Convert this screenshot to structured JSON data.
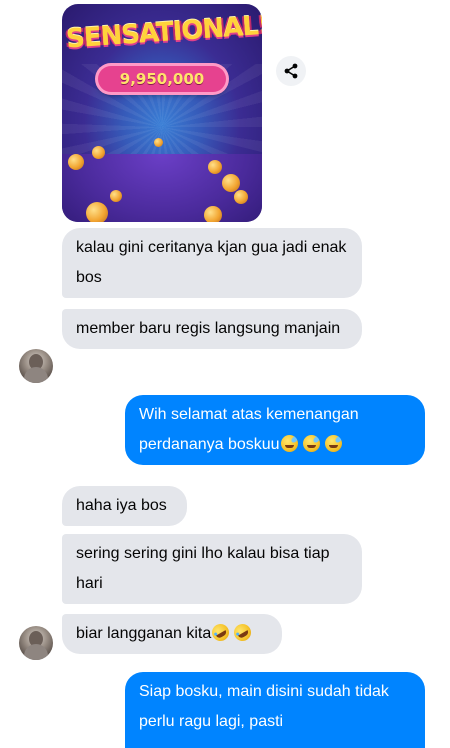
{
  "shared_image": {
    "title": "SENSATIONAL!",
    "amount": "9,950,000"
  },
  "messages": [
    {
      "text": "kalau gini ceritanya kjan gua jadi enak bos"
    },
    {
      "text": "member baru regis langsung manjain"
    },
    {
      "text": "Wih selamat atas kemenangan perdananya boskuu",
      "emoji": [
        "sweat-smile",
        "sweat-smile",
        "sweat-smile"
      ]
    },
    {
      "text": "haha iya bos"
    },
    {
      "text": "sering sering gini lho kalau bisa tiap hari"
    },
    {
      "text": "biar langganan kita",
      "emoji": [
        "rofl",
        "rofl"
      ]
    },
    {
      "text": "Siap bosku, main disini sudah tidak perlu ragu lagi, pasti"
    }
  ],
  "icons": {
    "share": "share-icon",
    "avatar": "contact-avatar"
  },
  "colors": {
    "incoming_bubble": "#e4e6eb",
    "outgoing_bubble": "#0084ff"
  }
}
